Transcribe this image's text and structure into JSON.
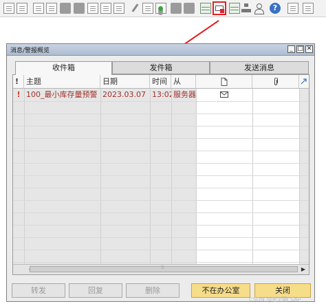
{
  "window": {
    "title": "消息/警报概览",
    "min_glyph": "_",
    "max_glyph": "□",
    "close_glyph": "✕"
  },
  "tabs": [
    {
      "label": "收件箱"
    },
    {
      "label": "发件箱"
    },
    {
      "label": "发送消息"
    }
  ],
  "table": {
    "headers": [
      "!",
      "主题",
      "日期",
      "时间",
      "从"
    ],
    "rows": [
      {
        "priority": "!",
        "subject": "100_最小库存量预警",
        "date": "2023.03.07",
        "time": "13:02",
        "from": "服务器"
      }
    ]
  },
  "scrollbar": {
    "left": "◀",
    "right": "▶",
    "grip": "⦙⦙⦙"
  },
  "buttons": {
    "forward": "转发",
    "reply": "回复",
    "delete": "删除",
    "out_of_office": "不在办公室",
    "close": "关闭"
  },
  "toolbar": {
    "help": "?"
  },
  "watermark": "CSDN @老刘聊 SAP",
  "colors": {
    "accent_text": "#a0302a",
    "highlight": "#e02020",
    "button_yellow": "#f6dd8a"
  }
}
